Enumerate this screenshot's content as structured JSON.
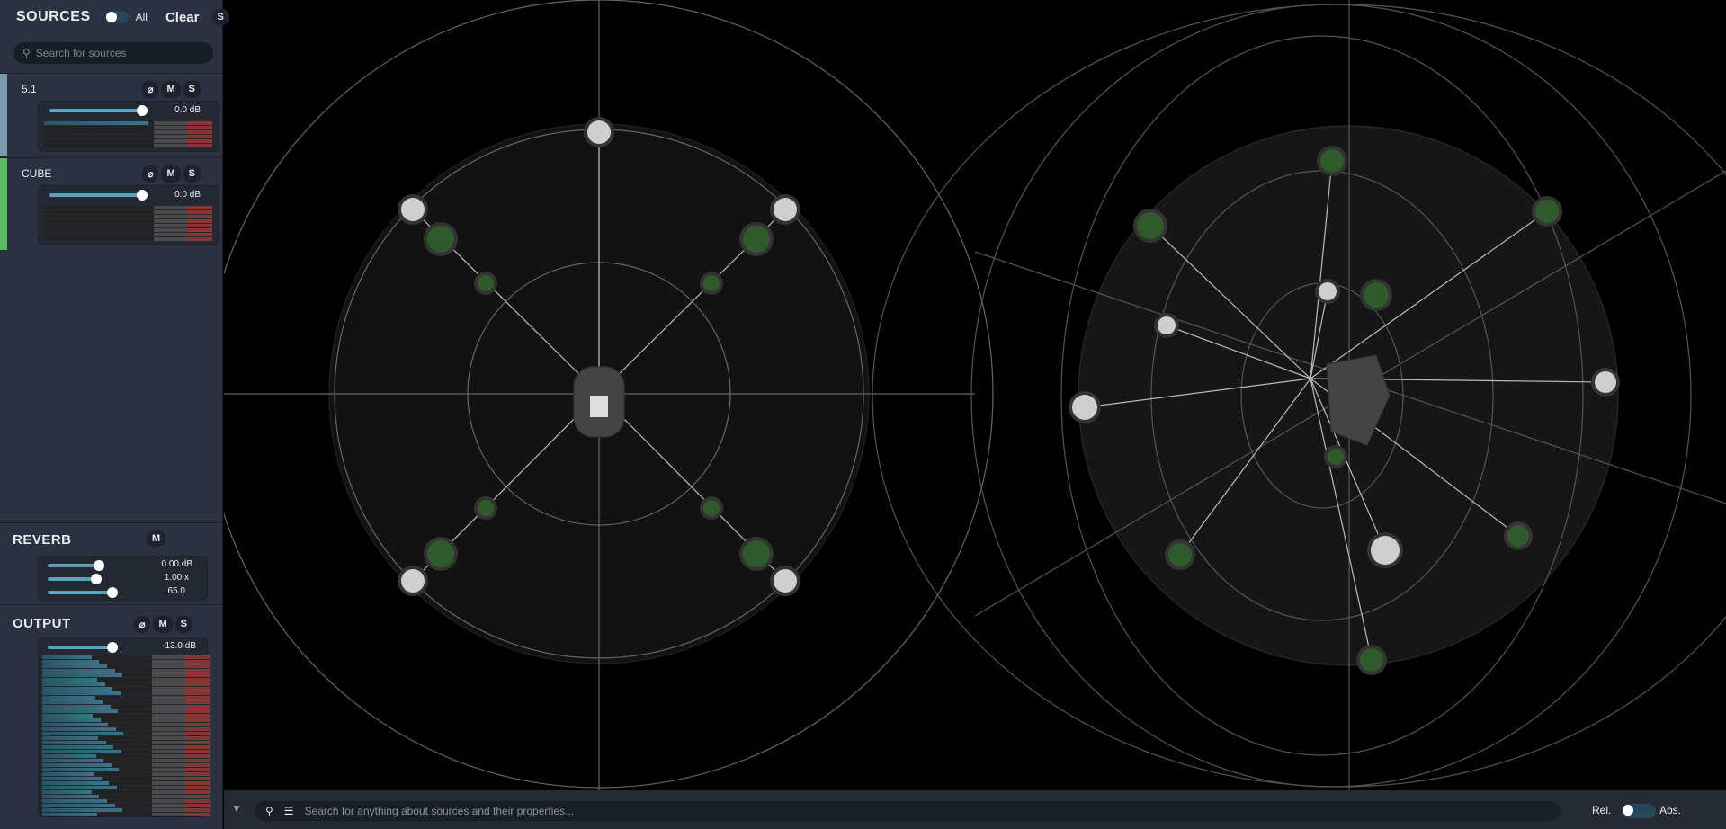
{
  "sources_header": {
    "title": "SOURCES",
    "all_label": "All",
    "clear_label": "Clear",
    "solo_label": "S",
    "search_placeholder": "Search for sources"
  },
  "sources": [
    {
      "name": "5.1",
      "color": "#7c9cac",
      "gain": "0.0 dB",
      "level": 0.86
    },
    {
      "name": "CUBE",
      "color": "#5cb85c",
      "gain": "0.0 dB",
      "level": 0.86
    }
  ],
  "buttons": {
    "phase": "⌀",
    "mute": "M",
    "solo": "S"
  },
  "reverb": {
    "title": "REVERB",
    "mute": "M",
    "params": [
      {
        "value": "0.00 dB",
        "level": 0.5
      },
      {
        "value": "1.00 x",
        "level": 0.47
      },
      {
        "value": "65.0",
        "level": 0.63
      }
    ]
  },
  "output": {
    "title": "OUTPUT",
    "gain": "-13.0 dB",
    "level": 0.63
  },
  "bottom": {
    "search_placeholder": "Search for anything about sources and their properties...",
    "rel_label": "Rel.",
    "abs_label": "Abs."
  }
}
